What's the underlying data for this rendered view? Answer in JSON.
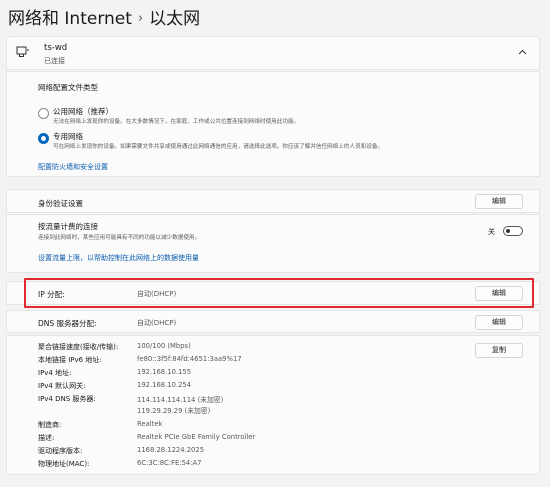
{
  "breadcrumb": {
    "parent": "网络和 Internet",
    "separator": "›",
    "current": "以太网"
  },
  "header": {
    "name": "ts-wd",
    "status": "已连接",
    "icon": "ethernet-icon",
    "chevron": "chevron-up-icon"
  },
  "profile": {
    "title": "网络配置文件类型",
    "public": {
      "label": "公用网络（推荐）",
      "desc": "无法在网络上发现你的设备。在大多数情况下，在家庭、工作或公共位置连接到网络时使用此功能。",
      "selected": false
    },
    "private": {
      "label": "专用网络",
      "desc": "可在网络上发现你的设备。如果需要文件共享或使用通过此网络通信的应用，请选择此选项。你应该了解并信任网络上的人员和设备。",
      "selected": true
    },
    "firewall_link": "配置防火墙和安全设置"
  },
  "auth": {
    "label": "身份验证设置",
    "button": "编辑"
  },
  "metered": {
    "label": "按流量计费的连接",
    "desc": "连接到此网络时，某些应用可能具有不同的功能以减少数据使用。",
    "toggle_label": "关",
    "toggle_on": false,
    "link": "设置流量上限，以帮助控制在此网络上的数据使用量"
  },
  "ip": {
    "label": "IP 分配:",
    "value": "自动(DHCP)",
    "button": "编辑"
  },
  "dns": {
    "label": "DNS 服务器分配:",
    "value": "自动(DHCP)",
    "button": "编辑"
  },
  "properties": {
    "copy_button": "复制",
    "items": [
      {
        "label": "聚合链接速度(接收/传输):",
        "value": "100/100 (Mbps)"
      },
      {
        "label": "本地链接 IPv6 地址:",
        "value": "fe80::3f5f:84fd:4651:3aa9%17"
      },
      {
        "label": "IPv4 地址:",
        "value": "192.168.10.155"
      },
      {
        "label": "IPv4 默认网关:",
        "value": "192.168.10.254"
      },
      {
        "label": "IPv4 DNS 服务器:",
        "value": "114.114.114.114 (未加密)",
        "value2": "119.29.29.29 (未加密)"
      },
      {
        "label": "制造商:",
        "value": "Realtek"
      },
      {
        "label": "描述:",
        "value": "Realtek PCIe GbE Family Controller"
      },
      {
        "label": "驱动程序版本:",
        "value": "1168.28.1224.2025"
      },
      {
        "label": "物理地址(MAC):",
        "value": "6C:3C:8C:FE:54:A7"
      }
    ]
  },
  "colors": {
    "accent": "#0067c0",
    "link": "#0a5cb0",
    "highlight": "#e0282e"
  }
}
